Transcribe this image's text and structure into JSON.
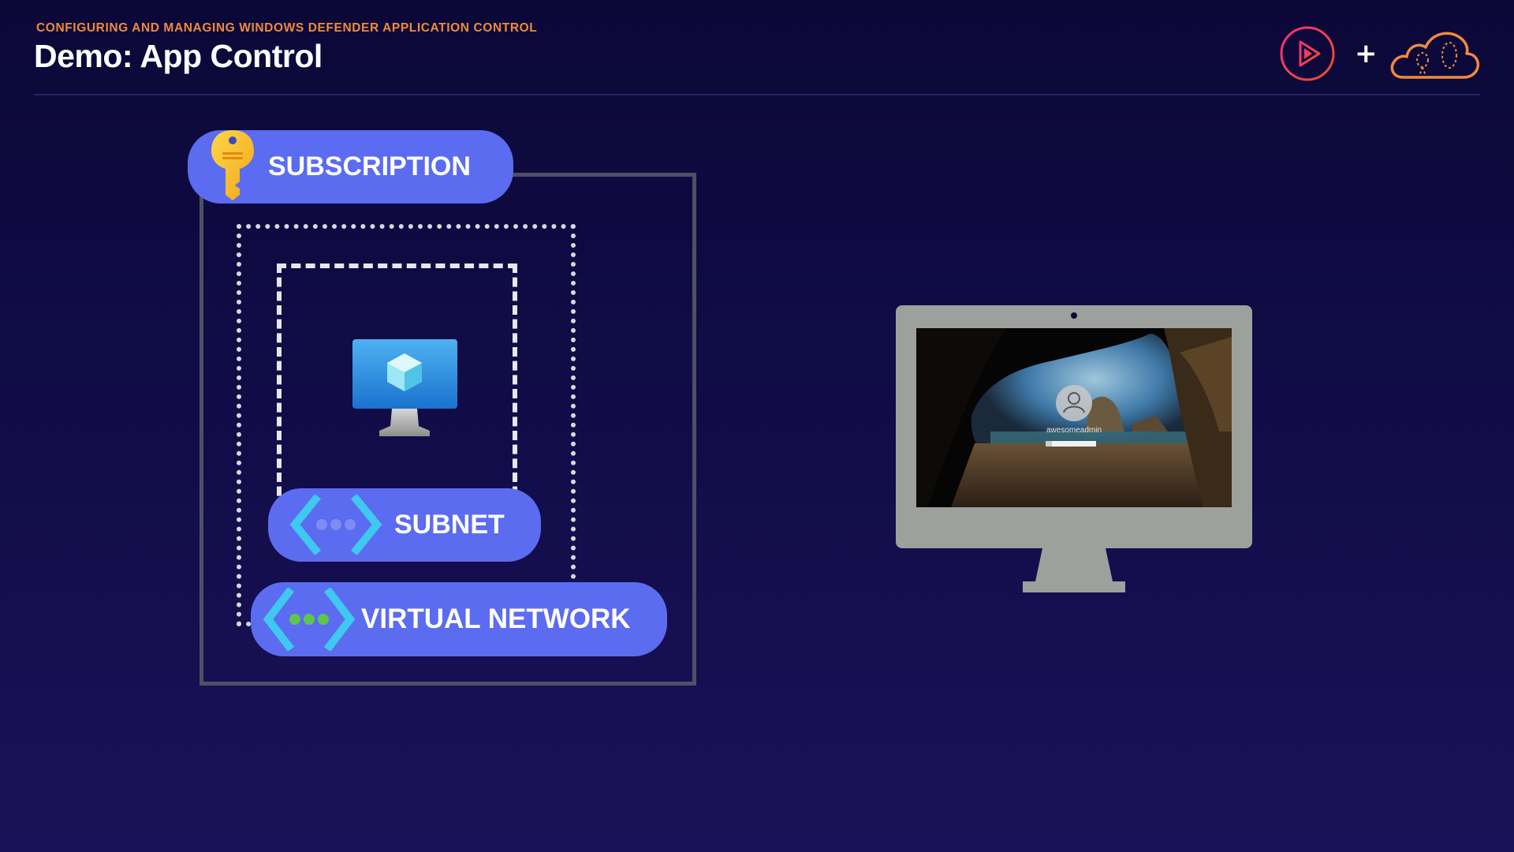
{
  "header": {
    "course_title": "CONFIGURING AND MANAGING WINDOWS DEFENDER APPLICATION CONTROL",
    "page_title": "Demo: App Control",
    "plus_symbol": "+"
  },
  "diagram": {
    "subscription_label": "SUBSCRIPTION",
    "subnet_label": "SUBNET",
    "virtual_network_label": "VIRTUAL NETWORK",
    "vm_icon": "azure-virtual-machine-icon"
  },
  "monitor": {
    "username": "awesomeadmin"
  },
  "colors": {
    "accent_orange": "#f08a3c",
    "pill_blue": "#5b6cf0",
    "background": "#120d4a"
  }
}
